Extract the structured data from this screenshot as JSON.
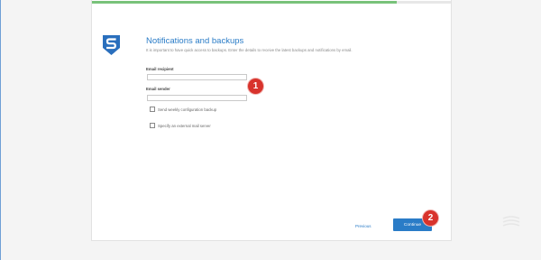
{
  "wizard": {
    "progress_fraction": 0.85,
    "title": "Notifications and backups",
    "subtitle": "It is important to have quick access to backups. Enter the details to receive the latest backups and notifications by email."
  },
  "form": {
    "email_recipient_label": "Email recipient",
    "email_recipient_value": "",
    "email_sender_label": "Email sender",
    "email_sender_value": "",
    "weekly_backup_label": "Send weekly configuration backup",
    "external_mail_label": "Specify an external mail server"
  },
  "footer": {
    "previous_label": "Previous",
    "continue_label": "Continue"
  },
  "annotations": {
    "badge_1": "1",
    "badge_2": "2"
  },
  "colors": {
    "accent": "#2a7cc7",
    "progress": "#79c27a",
    "badge": "#d8332c"
  },
  "icons": {
    "logo": "sophos-shield-icon",
    "watermark": "ribbon-watermark-icon"
  }
}
